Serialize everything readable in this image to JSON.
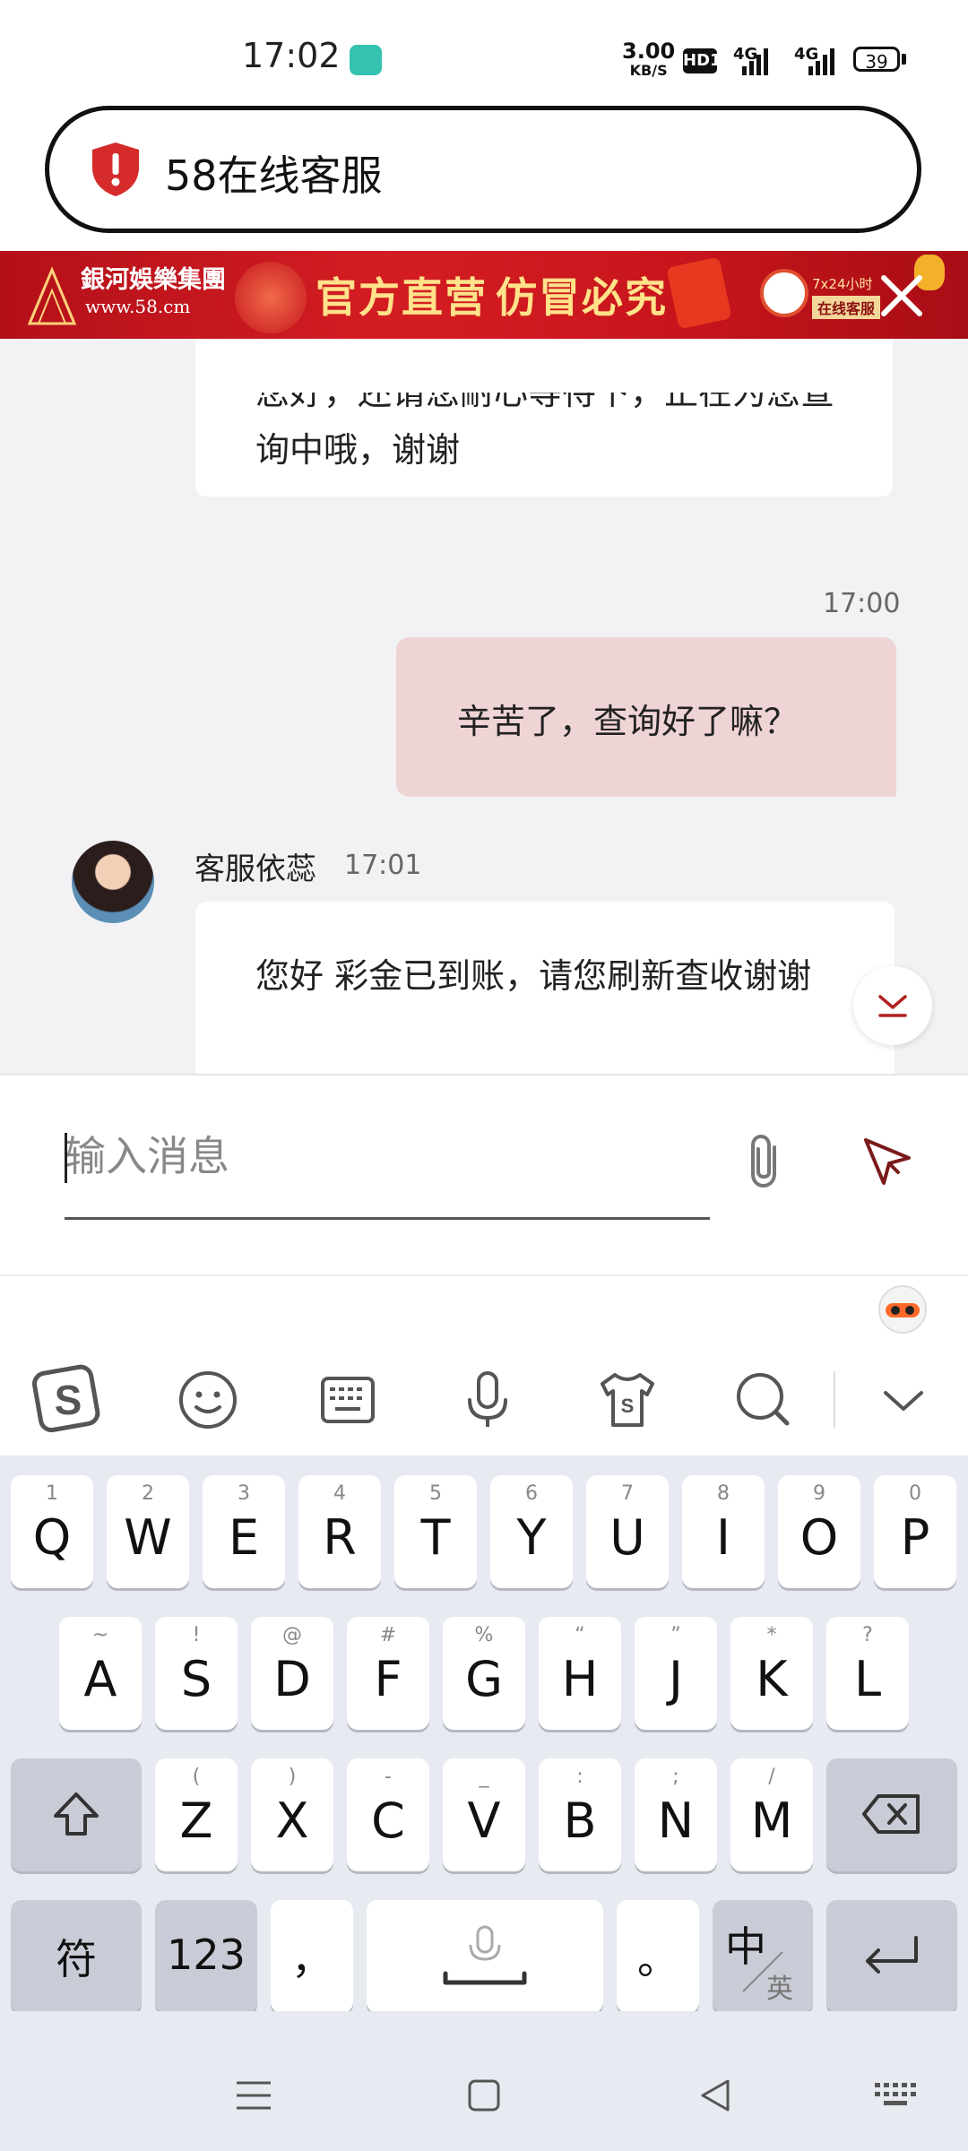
{
  "status": {
    "time": "17:02",
    "speed_value": "3.00",
    "speed_unit": "KB/S",
    "hd_badge": "HD1",
    "net1": "4G",
    "net2": "4G",
    "battery": "39"
  },
  "browser": {
    "title": "58在线客服"
  },
  "banner": {
    "brand": "銀河娛樂集團",
    "brand_url": "www.58.cm",
    "slogan1": "官方直营",
    "slogan2": "仿冒必究",
    "service_247": "7x24小时",
    "service_online": "在线客服"
  },
  "chat": {
    "messages": [
      {
        "sender": "agent",
        "text": "您好，还请您耐心等待下，正在为您查询中哦，谢谢"
      },
      {
        "sender": "me",
        "time": "17:00",
        "text": "辛苦了，查询好了嘛？"
      },
      {
        "sender": "agent",
        "name": "客服依蕊",
        "time": "17:01",
        "text": "您好 彩金已到账，请您刷新查收谢谢"
      }
    ]
  },
  "composer": {
    "placeholder": "输入消息",
    "value": ""
  },
  "ime_toolbar": {
    "icons": [
      "sogou-logo-icon",
      "emoji-icon",
      "keyboard-icon",
      "microphone-icon",
      "skin-shirt-icon",
      "search-icon",
      "collapse-chevron-icon"
    ]
  },
  "keyboard": {
    "row1": [
      {
        "k": "Q",
        "s": "1"
      },
      {
        "k": "W",
        "s": "2"
      },
      {
        "k": "E",
        "s": "3"
      },
      {
        "k": "R",
        "s": "4"
      },
      {
        "k": "T",
        "s": "5"
      },
      {
        "k": "Y",
        "s": "6"
      },
      {
        "k": "U",
        "s": "7"
      },
      {
        "k": "I",
        "s": "8"
      },
      {
        "k": "O",
        "s": "9"
      },
      {
        "k": "P",
        "s": "0"
      }
    ],
    "row2": [
      {
        "k": "A",
        "s": "~"
      },
      {
        "k": "S",
        "s": "!"
      },
      {
        "k": "D",
        "s": "@"
      },
      {
        "k": "F",
        "s": "#"
      },
      {
        "k": "G",
        "s": "%"
      },
      {
        "k": "H",
        "s": "“"
      },
      {
        "k": "J",
        "s": "”"
      },
      {
        "k": "K",
        "s": "*"
      },
      {
        "k": "L",
        "s": "?"
      }
    ],
    "row3": [
      {
        "k": "Z",
        "s": "("
      },
      {
        "k": "X",
        "s": ")"
      },
      {
        "k": "C",
        "s": "-"
      },
      {
        "k": "V",
        "s": "_"
      },
      {
        "k": "B",
        "s": ":"
      },
      {
        "k": "N",
        "s": ";"
      },
      {
        "k": "M",
        "s": "/"
      }
    ],
    "symbols": "符",
    "numbers": "123",
    "comma": "，",
    "period": "。",
    "lang_main": "中",
    "lang_sub": "英"
  },
  "colors": {
    "my_bubble": "#efd4d5",
    "banner_red": "#c8151c",
    "send_icon": "#7a1a1a"
  }
}
